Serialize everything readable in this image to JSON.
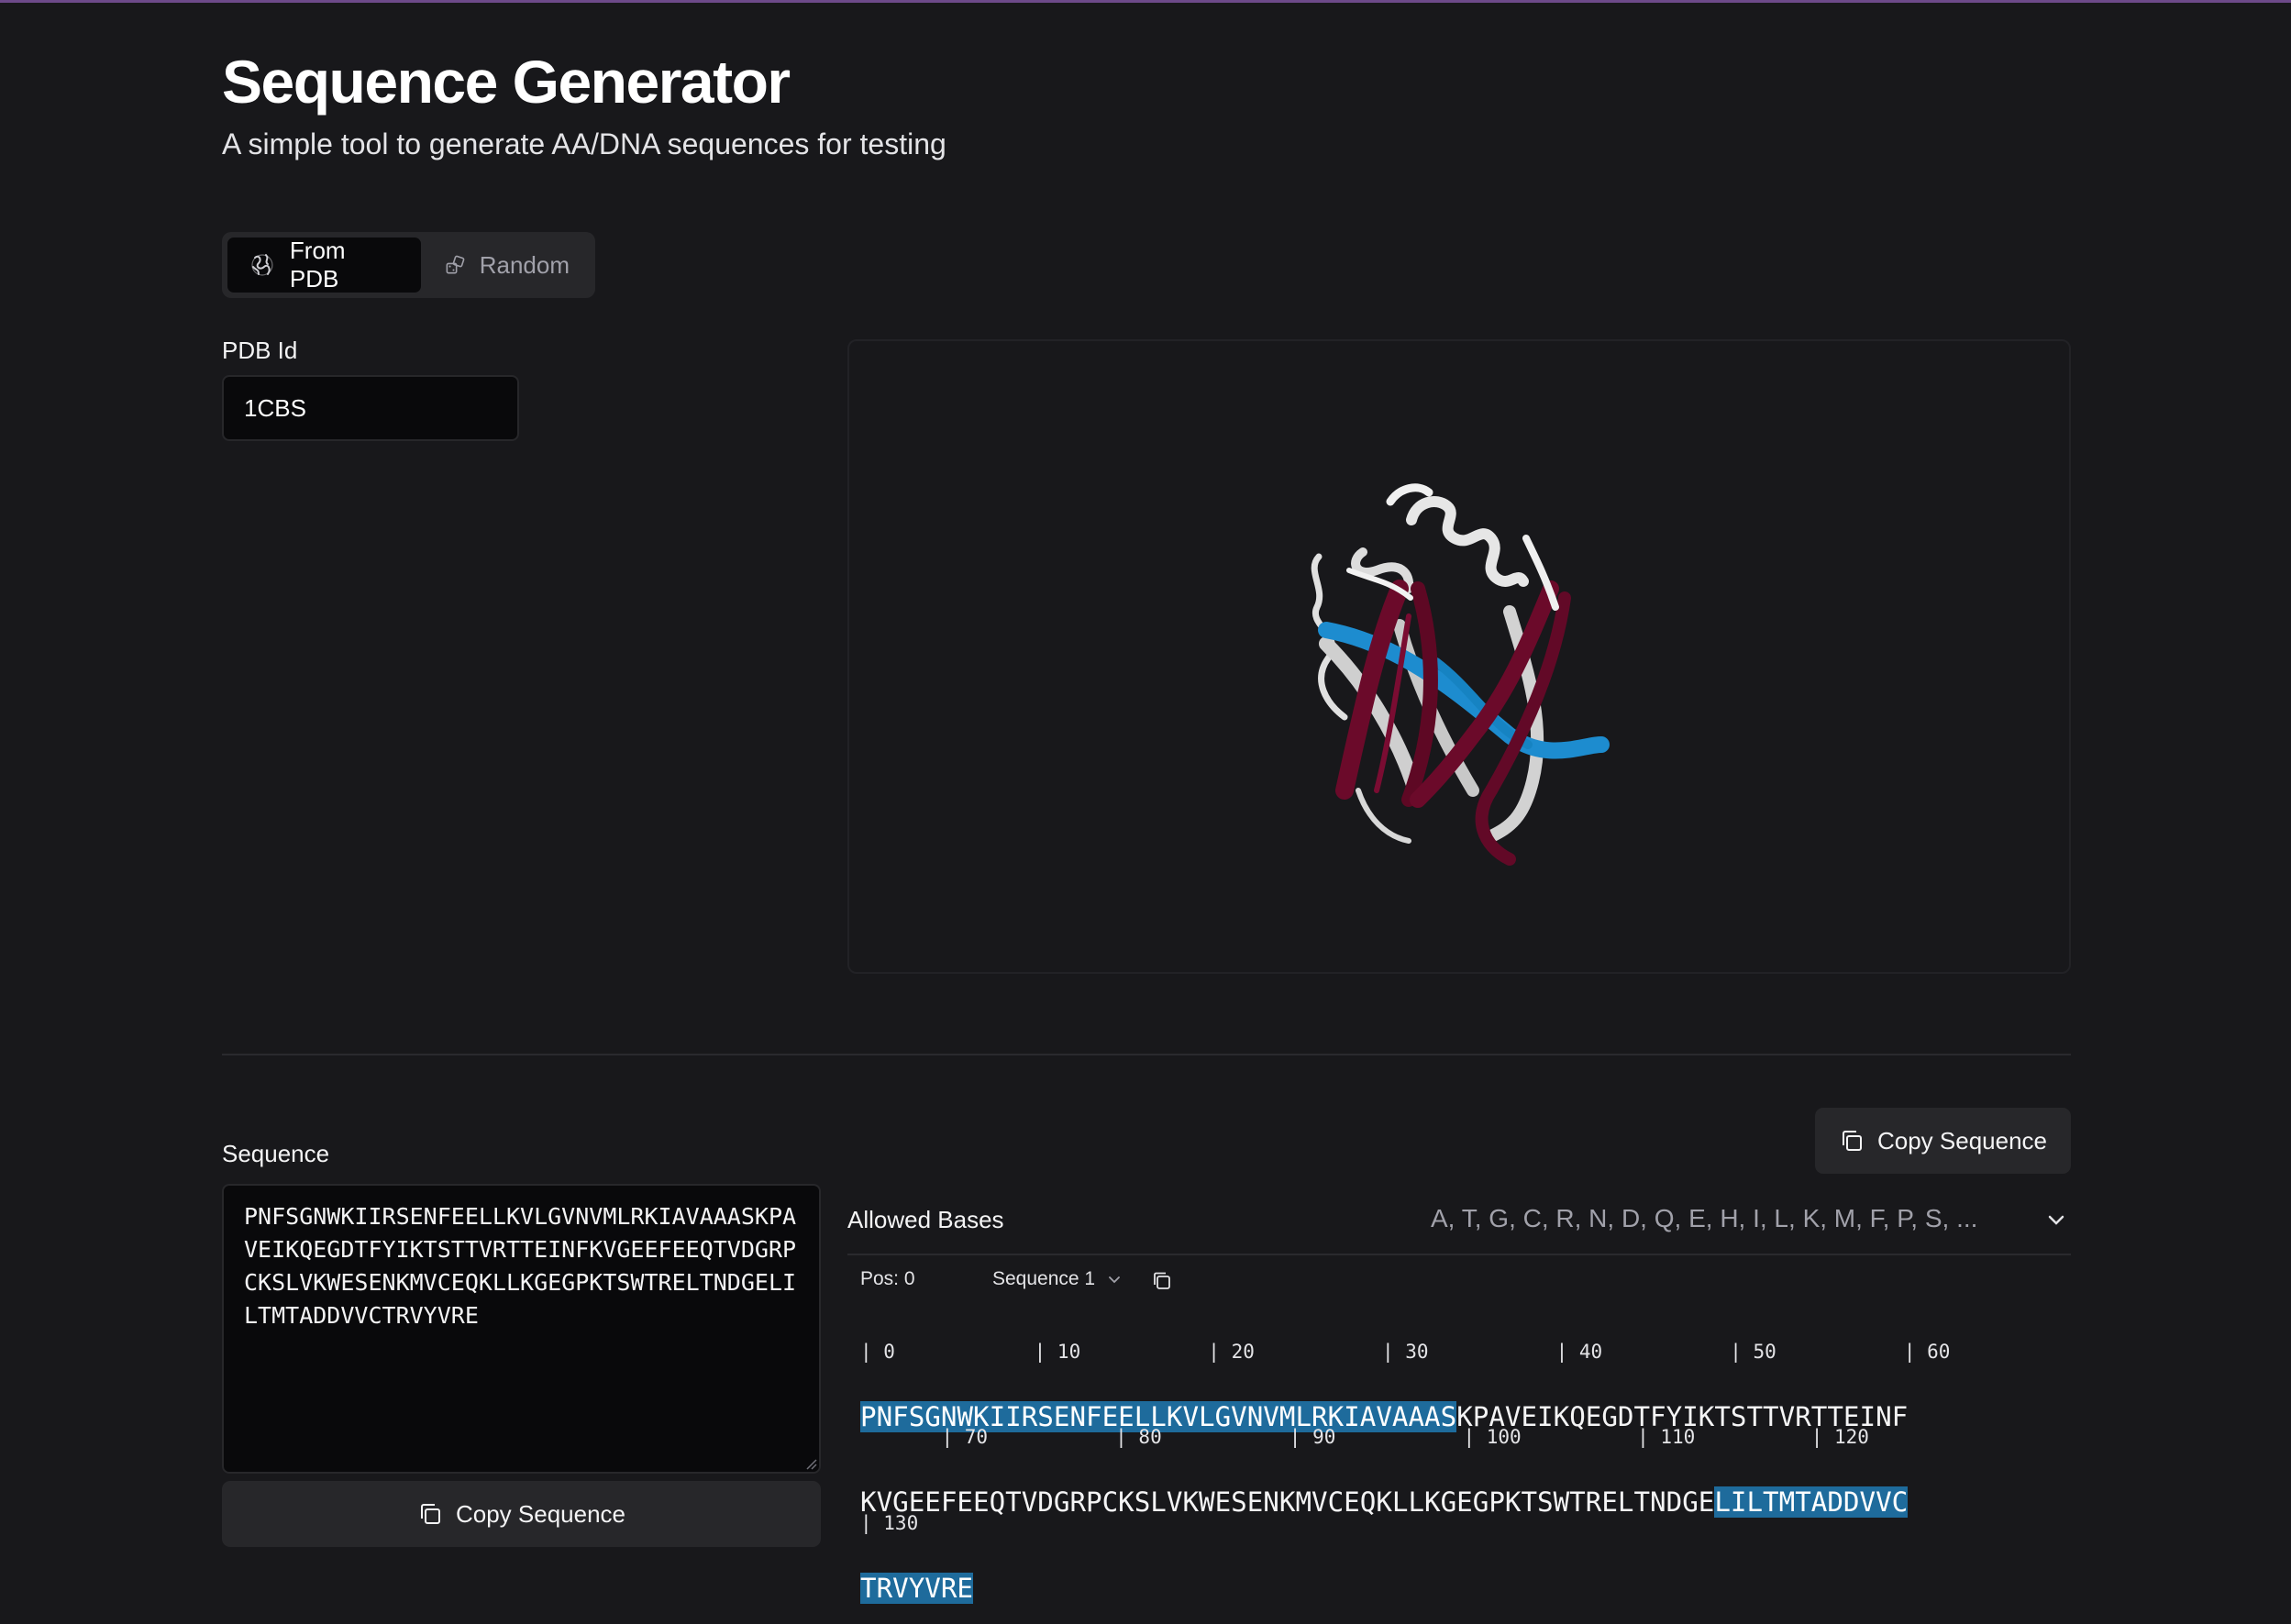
{
  "header": {
    "title": "Sequence Generator",
    "subtitle": "A simple tool to generate AA/DNA sequences for testing"
  },
  "modes": {
    "from_pdb": "From PDB",
    "random": "Random",
    "active": "From PDB"
  },
  "pdb": {
    "label": "PDB Id",
    "value": "1CBS"
  },
  "viewer": {
    "structure": "1CBS",
    "colors": {
      "helix": "#e8e8e8",
      "strand_primary": "#6b0a2a",
      "strand_secondary": "#1d8ccf",
      "coil": "#d8d8d8"
    }
  },
  "sequence_panel": {
    "label": "Sequence",
    "text": "PNFSGNWKIIRSENFEELLKVLGVNVMLRKIAVAAASKPAVEIKQEGDTFYIKTSTTVRTTEINFKVGEEFEEQTVDGRPCKSLVKWESENKMVCEQKLLKGEGPKTSWTRELTNDGELILTMTADDVVCTRVYVRE",
    "copy_label": "Copy Sequence"
  },
  "viz_panel": {
    "copy_label": "Copy Sequence",
    "allowed_label": "Allowed Bases",
    "allowed_value": "A, T, G, C, R, N, D, Q, E, H, I, L, K, M, F, P, S, ...",
    "pos_label": "Pos: 0",
    "sequence_select": "Sequence 1",
    "lines": [
      {
        "ruler": "| 0            | 10           | 20           | 30           | 40           | 50           | 60",
        "segments": [
          {
            "text": "PNFSGNWKIIRSENFEELLKVLGVNVMLRKIAVAAAS",
            "highlight": true
          },
          {
            "text": "KPAVEIKQEGDTFYIKTSTTVRTTEINF",
            "highlight": false
          }
        ]
      },
      {
        "ruler": "       | 70           | 80           | 90           | 100          | 110          | 120",
        "segments": [
          {
            "text": "KVGEEFEEQTVDGRPCKSLVKWESENKMVCEQKLLKGEGPKTSWTRELTNDGE",
            "highlight": false
          },
          {
            "text": "LILTMTADDVVC",
            "highlight": true
          }
        ]
      },
      {
        "ruler": "| 130",
        "segments": [
          {
            "text": "TRVYVRE",
            "highlight": true
          }
        ]
      }
    ],
    "highlight_color": "#1e6b9c"
  }
}
